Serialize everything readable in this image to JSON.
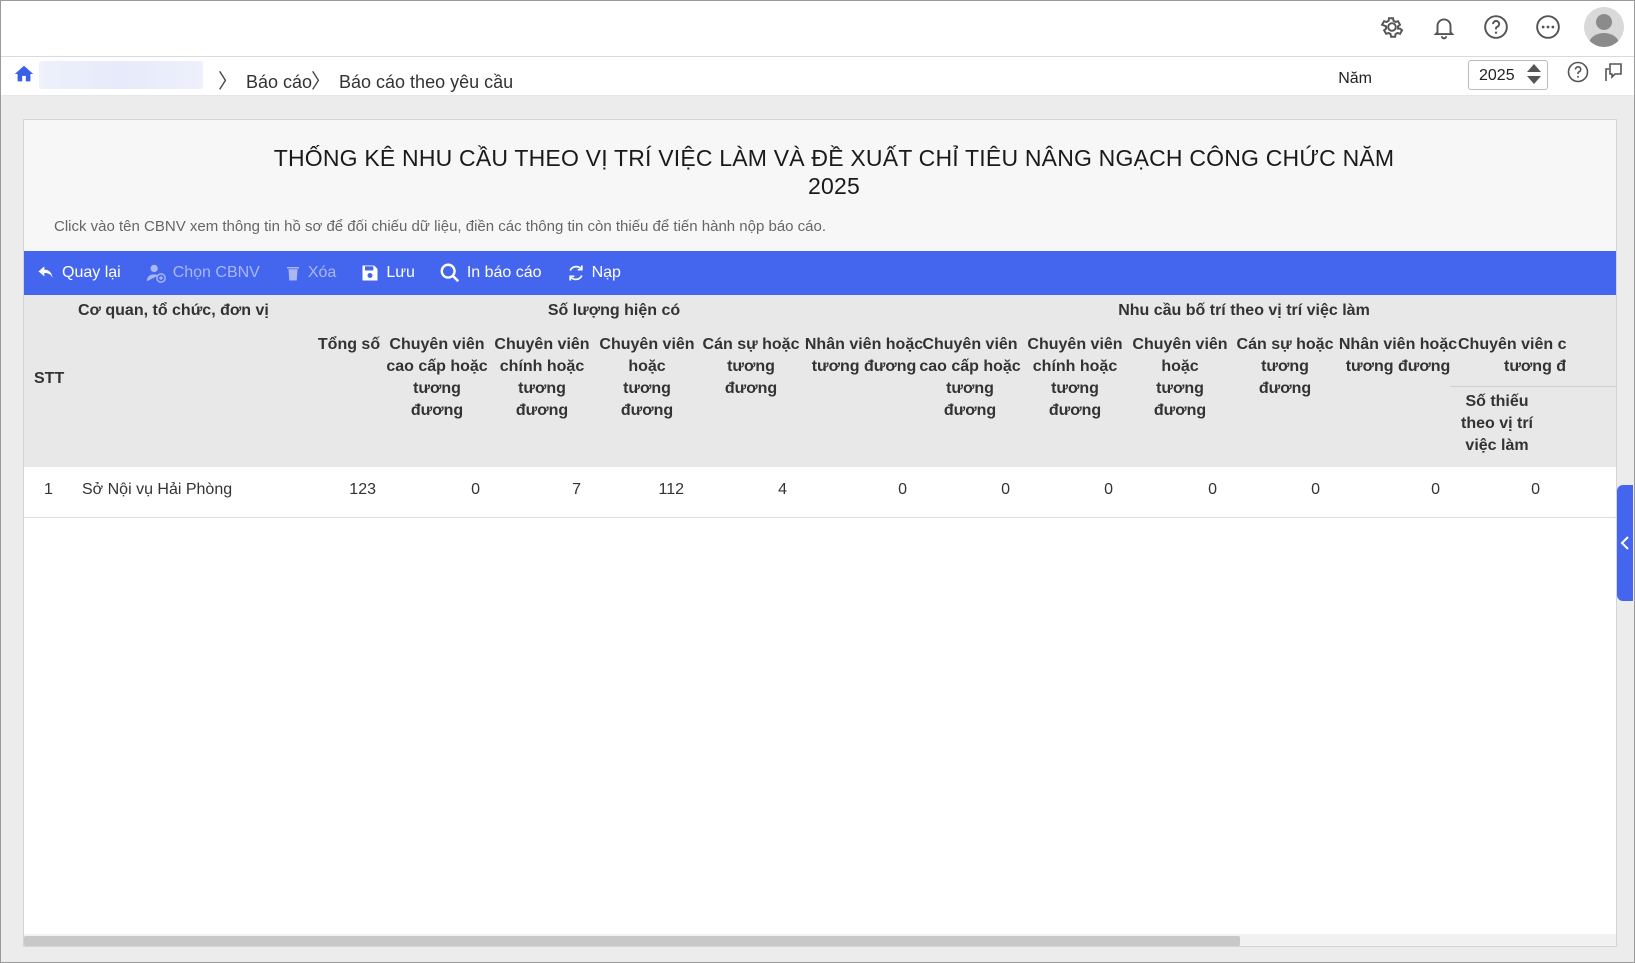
{
  "topbar": {
    "icons": [
      "gear-icon",
      "bell-icon",
      "help-icon",
      "more-icon",
      "avatar"
    ]
  },
  "breadcrumb": {
    "items": [
      "Báo cáo",
      "Báo cáo theo yêu cầu"
    ],
    "year_label": "Năm",
    "year_value": "2025"
  },
  "report": {
    "title_line1": "THỐNG KÊ NHU CẦU THEO VỊ TRÍ VIỆC LÀM VÀ ĐỀ XUẤT CHỈ TIÊU NÂNG NGẠCH CÔNG CHỨC NĂM",
    "title_line2": "2025",
    "hint": "Click vào tên CBNV xem thông tin hồ sơ để đối chiếu dữ liệu, điền các thông tin còn thiếu để tiến hành nộp báo cáo."
  },
  "toolbar": {
    "back": "Quay lại",
    "choose": "Chọn CBNV",
    "delete": "Xóa",
    "save": "Lưu",
    "print": "In báo cáo",
    "reload": "Nạp"
  },
  "table": {
    "col_stt": "STT",
    "col_org": "Cơ quan, tổ chức, đơn vị",
    "group_current": "Số lượng hiện có",
    "group_need": "Nhu cầu bố trí theo vị trí việc làm",
    "h_total": "Tổng số",
    "h1": [
      "Chuyên viên",
      "cao cấp hoặc",
      "tương đương"
    ],
    "h2": [
      "Chuyên viên",
      "chính hoặc",
      "tương đương"
    ],
    "h3": [
      "Chuyên viên",
      "hoặc",
      "tương đương"
    ],
    "h4": [
      "Cán sự hoặc",
      "tương đương"
    ],
    "h5": [
      "Nhân viên hoặc",
      "tương đương"
    ],
    "h6_partial": [
      "Chuyên viên c",
      "tương đ"
    ],
    "h_sub_missing": [
      "Số thiếu",
      "theo vị trí",
      "việc làm"
    ],
    "rows": [
      {
        "stt": "1",
        "org": "Sở Nội vụ Hải Phòng",
        "values": [
          "123",
          "0",
          "7",
          "112",
          "4",
          "0",
          "0",
          "0",
          "0",
          "0",
          "0",
          "0"
        ]
      }
    ]
  }
}
